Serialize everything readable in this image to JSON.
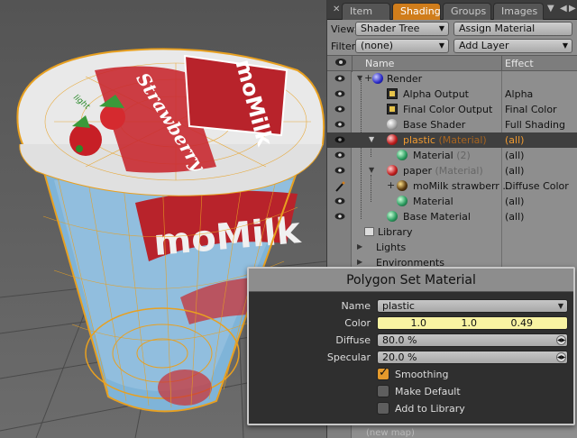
{
  "tabs": {
    "items": [
      "Item ...",
      "Shading",
      "Groups",
      "Images"
    ],
    "active": "Shading"
  },
  "toolbar": {
    "view_label": "View",
    "view_value": "Shader Tree",
    "assign_material": "Assign Material",
    "filter_label": "Filter",
    "filter_value": "(none)",
    "add_layer": "Add Layer"
  },
  "tree": {
    "col_name": "Name",
    "col_effect": "Effect",
    "rows": [
      {
        "name": "Render",
        "type": "",
        "effect": ""
      },
      {
        "name": "Alpha Output",
        "type": "",
        "effect": "Alpha"
      },
      {
        "name": "Final Color Output",
        "type": "",
        "effect": "Final Color"
      },
      {
        "name": "Base Shader",
        "type": "",
        "effect": "Full Shading"
      },
      {
        "name": "plastic",
        "type": "(Material)",
        "effect": "(all)"
      },
      {
        "name": "Material",
        "type": "(2)",
        "effect": "(all)"
      },
      {
        "name": "paper",
        "type": "(Material)",
        "effect": "(all)"
      },
      {
        "name": "moMilk strawberr ...",
        "type": "",
        "effect": "Diffuse Color"
      },
      {
        "name": "Material",
        "type": "",
        "effect": "(all)"
      },
      {
        "name": "Base Material",
        "type": "",
        "effect": "(all)"
      }
    ],
    "library": "Library",
    "lights": "Lights",
    "environments": "Environments",
    "under_dialog": "(new map)"
  },
  "dialog": {
    "title": "Polygon Set Material",
    "name_label": "Name",
    "name_value": "plastic",
    "color_label": "Color",
    "color_r": "1.0",
    "color_g": "1.0",
    "color_b": "0.49",
    "diffuse_label": "Diffuse",
    "diffuse_value": "80.0 %",
    "specular_label": "Specular",
    "specular_value": "20.0 %",
    "smoothing_label": "Smoothing",
    "smoothing_checked": true,
    "make_default_label": "Make Default",
    "make_default_checked": false,
    "add_library_label": "Add to Library",
    "add_library_checked": false
  },
  "viewport": {
    "label_brand": "moMilk",
    "label_flavor": "Strawberry",
    "label_tag": "light",
    "colors": {
      "selection": "#e8a020",
      "label_red": "#b8232b",
      "cup_blue": "#6aa6d0"
    }
  },
  "colors": {
    "accent": "#d07d1b",
    "selected_text": "#f09a30",
    "color_swatch": "#f8f3a2"
  }
}
